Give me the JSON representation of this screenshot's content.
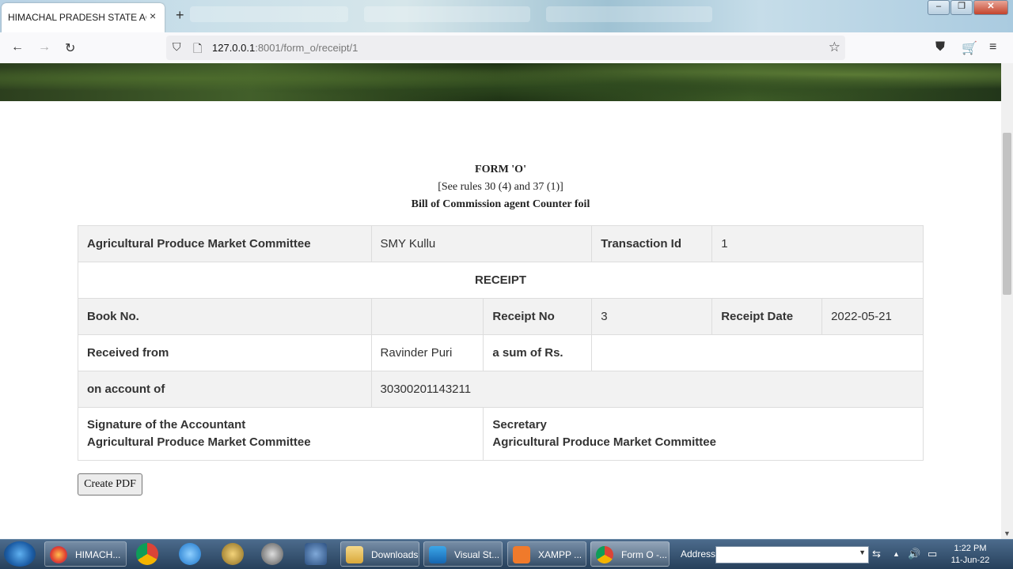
{
  "browser": {
    "tab_title": "HIMACHAL PRADESH STATE AGRIC",
    "tab_close": "×",
    "new_tab": "+",
    "url_host": "127.0.0.1",
    "url_path": ":8001/form_o/receipt/1"
  },
  "form": {
    "heading": "FORM 'O'",
    "subheading": "[See rules 30 (4) and 37 (1)]",
    "title": "Bill of Commission agent Counter foil"
  },
  "receipt": {
    "apmc_label": "Agricultural Produce Market Committee",
    "apmc_value": "SMY Kullu",
    "transaction_label": "Transaction Id",
    "transaction_value": "1",
    "receipt_heading": "RECEIPT",
    "book_label": "Book No.",
    "book_value": "",
    "receipt_no_label": "Receipt No",
    "receipt_no_value": "3",
    "receipt_date_label": "Receipt Date",
    "receipt_date_value": "2022-05-21",
    "received_from_label": "Received from",
    "received_from_value": "Ravinder Puri",
    "sum_label": "a sum of Rs.",
    "sum_value": "",
    "account_label": "on account of",
    "account_value": "30300201143211",
    "sig_accountant_line1": "Signature of the Accountant",
    "sig_accountant_line2": "Agricultural Produce Market Committee",
    "sig_secretary_line1": "Secretary",
    "sig_secretary_line2": "Agricultural Produce Market Committee"
  },
  "actions": {
    "create_pdf": "Create PDF"
  },
  "taskbar": {
    "items": [
      {
        "label": "HIMACH...",
        "icon": "firefox-icon"
      },
      {
        "label": "Downloads",
        "icon": "folder-icon"
      },
      {
        "label": "Visual St...",
        "icon": "vscode-icon"
      },
      {
        "label": "XAMPP ...",
        "icon": "xampp-icon"
      },
      {
        "label": "Form O -...",
        "icon": "chrome-icon"
      }
    ],
    "address_label": "Address",
    "time": "1:22 PM",
    "date": "11-Jun-22"
  },
  "colors": {
    "table_stripe": "#f2f2f2",
    "table_border": "#dddddd",
    "taskbar": "#2e4a68"
  }
}
